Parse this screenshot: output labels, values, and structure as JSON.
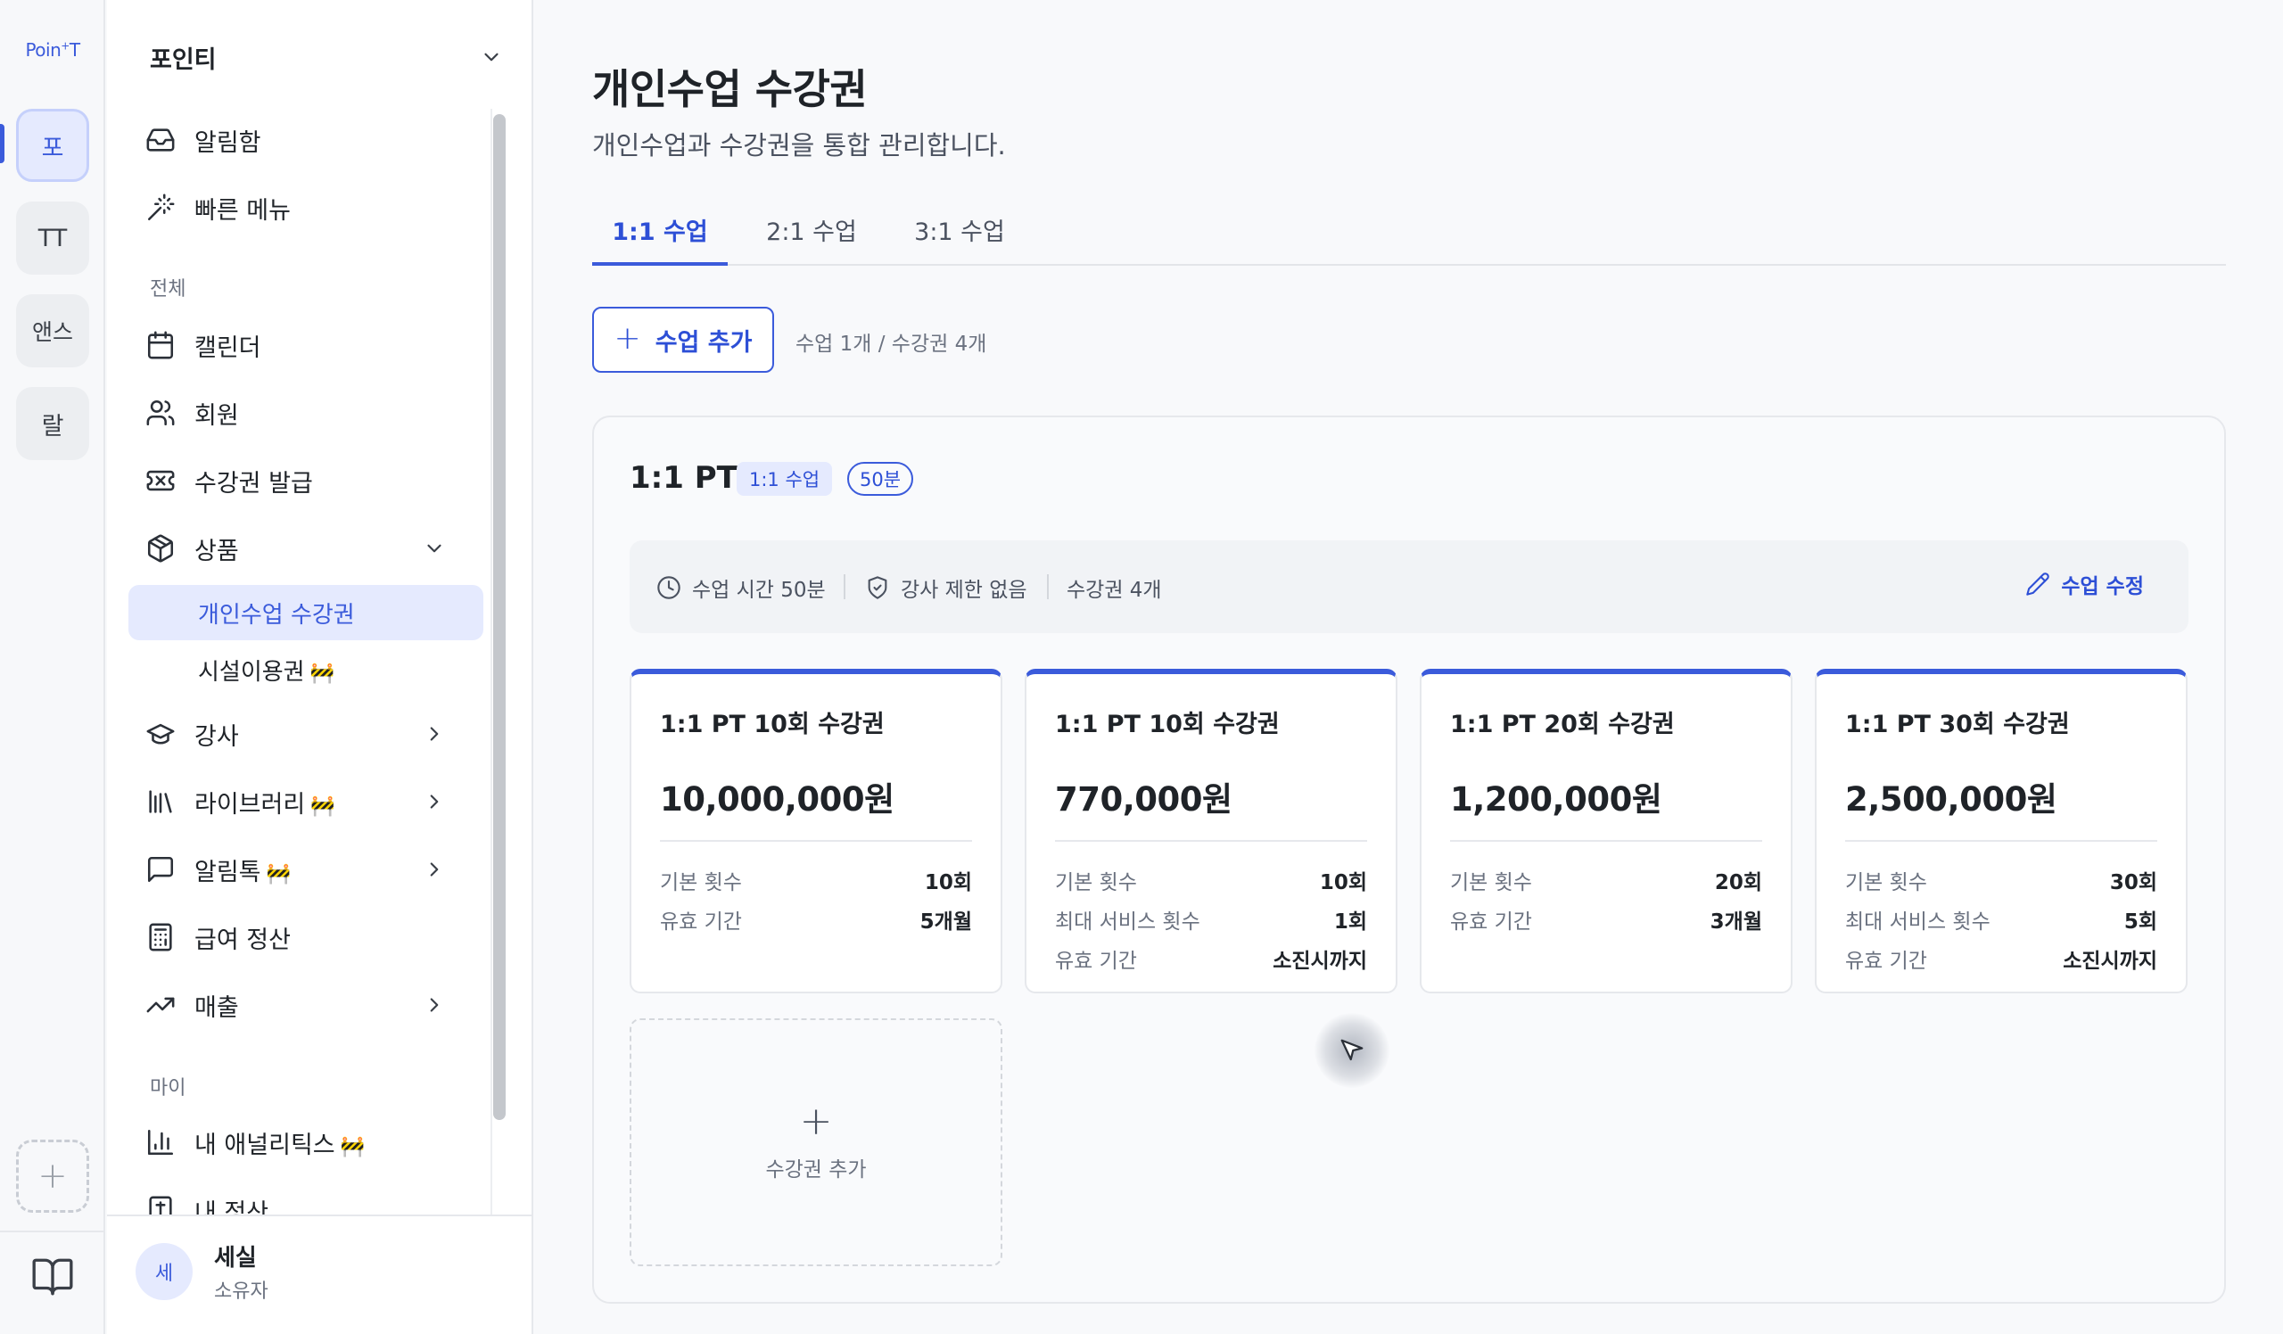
{
  "rail": {
    "logo": "Poin",
    "logo_sup": "+",
    "logo_tail": "T",
    "workspaces": [
      "포",
      "TT",
      "앤스",
      "랄"
    ],
    "add_icon": "plus-icon",
    "bottom_icon": "book-icon"
  },
  "sidebar": {
    "workspace_name": "포인티",
    "top_items": [
      {
        "label": "알림함",
        "icon": "inbox-icon"
      },
      {
        "label": "빠른 메뉴",
        "icon": "magic-wand-icon"
      }
    ],
    "section_all": "전체",
    "items": [
      {
        "label": "캘린더",
        "icon": "calendar-icon"
      },
      {
        "label": "회원",
        "icon": "users-icon"
      },
      {
        "label": "수강권 발급",
        "icon": "ticket-icon"
      },
      {
        "label": "상품",
        "icon": "box-icon"
      },
      {
        "label": "강사",
        "icon": "graduation-cap-icon"
      },
      {
        "label": "라이브러리",
        "icon": "library-icon",
        "wip": "🚧"
      },
      {
        "label": "알림톡",
        "icon": "message-icon",
        "wip": "🚧"
      },
      {
        "label": "급여 정산",
        "icon": "calculator-icon"
      },
      {
        "label": "매출",
        "icon": "trending-up-icon"
      }
    ],
    "sub_items": [
      {
        "label": "개인수업 수강권",
        "active": true
      },
      {
        "label": "시설이용권",
        "wip": "🚧"
      }
    ],
    "section_my": "마이",
    "my_items": [
      {
        "label": "내 애널리틱스",
        "icon": "bar-chart-icon",
        "wip": "🚧"
      },
      {
        "label": "내 정산",
        "icon": "receipt-icon"
      }
    ],
    "user": {
      "avatar": "세",
      "name": "세실",
      "role": "소유자"
    }
  },
  "main": {
    "title": "개인수업 수강권",
    "subtitle": "개인수업과 수강권을 통합 관리합니다.",
    "tabs": [
      {
        "label": "1:1 수업",
        "active": true
      },
      {
        "label": "2:1 수업",
        "active": false
      },
      {
        "label": "3:1 수업",
        "active": false
      }
    ],
    "add_class_label": "수업 추가",
    "count_text": "수업 1개 / 수강권 4개",
    "class_card": {
      "title": "1:1 PT",
      "badge_type": "1:1 수업",
      "badge_duration": "50분",
      "info": {
        "duration": "수업 시간 50분",
        "instructor": "강사 제한 없음",
        "passes": "수강권 4개",
        "edit_label": "수업 수정"
      },
      "passes": [
        {
          "name": "1:1 PT 10회 수강권",
          "price": "10,000,000원",
          "rows": [
            {
              "k": "기본 횟수",
              "v": "10회"
            },
            {
              "k": "유효 기간",
              "v": "5개월"
            }
          ]
        },
        {
          "name": "1:1 PT 10회 수강권",
          "price": "770,000원",
          "rows": [
            {
              "k": "기본 횟수",
              "v": "10회"
            },
            {
              "k": "최대 서비스 횟수",
              "v": "1회"
            },
            {
              "k": "유효 기간",
              "v": "소진시까지"
            }
          ]
        },
        {
          "name": "1:1 PT 20회 수강권",
          "price": "1,200,000원",
          "rows": [
            {
              "k": "기본 횟수",
              "v": "20회"
            },
            {
              "k": "유효 기간",
              "v": "3개월"
            }
          ]
        },
        {
          "name": "1:1 PT 30회 수강권",
          "price": "2,500,000원",
          "rows": [
            {
              "k": "기본 횟수",
              "v": "30회"
            },
            {
              "k": "최대 서비스 횟수",
              "v": "5회"
            },
            {
              "k": "유효 기간",
              "v": "소진시까지"
            }
          ]
        }
      ],
      "add_pass_label": "수강권 추가"
    }
  },
  "colors": {
    "accent": "#3b5bdb",
    "accent_light": "#e5eafe",
    "text": "#1f2328",
    "muted": "#6b7280"
  }
}
